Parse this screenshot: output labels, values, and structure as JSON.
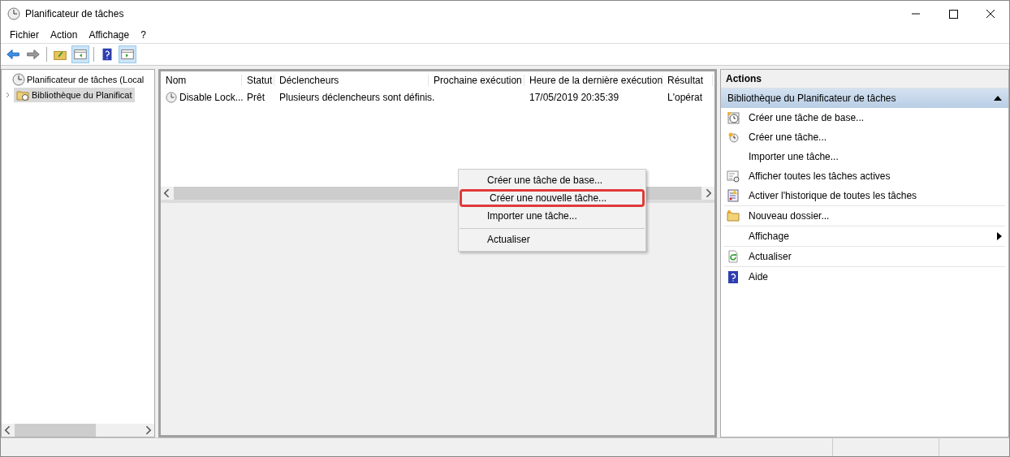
{
  "window": {
    "title": "Planificateur de tâches"
  },
  "menu": [
    "Fichier",
    "Action",
    "Affichage",
    "?"
  ],
  "toolbar": [
    {
      "kind": "back",
      "pressed": false
    },
    {
      "kind": "forward",
      "pressed": false
    },
    {
      "kind": "sep"
    },
    {
      "kind": "up",
      "pressed": false
    },
    {
      "kind": "pane-left",
      "pressed": true
    },
    {
      "kind": "sep"
    },
    {
      "kind": "help",
      "pressed": false
    },
    {
      "kind": "pane-right",
      "pressed": true
    }
  ],
  "tree": [
    {
      "label": "Planificateur de tâches (Local",
      "selected": false,
      "children": [
        {
          "label": "Bibliothèque du Planificat",
          "expanded": false,
          "selected": true
        }
      ]
    }
  ],
  "table": {
    "columns": [
      "Nom",
      "Statut",
      "Déclencheurs",
      "Prochaine exécution",
      "Heure de la dernière exécution",
      "Résultat"
    ],
    "rows": [
      [
        "Disable Lock...",
        "Prêt",
        "Plusieurs déclencheurs sont définis.",
        "",
        "17/05/2019 20:35:39",
        "L'opérat"
      ]
    ]
  },
  "context_menu": [
    {
      "label": "Créer une tâche de base...",
      "highlighted": false,
      "divider_before": false
    },
    {
      "label": "Créer une nouvelle tâche...",
      "highlighted": true,
      "divider_before": false
    },
    {
      "label": "Importer une tâche...",
      "highlighted": false,
      "divider_before": false
    },
    {
      "label": "Actualiser",
      "highlighted": false,
      "divider_before": true
    }
  ],
  "actions": {
    "title": "Actions",
    "section": "Bibliothèque du Planificateur de tâches",
    "items": [
      {
        "label": "Créer une tâche de base...",
        "submenu": false,
        "divider": false
      },
      {
        "label": "Créer une tâche...",
        "submenu": false,
        "divider": false
      },
      {
        "label": "Importer une tâche...",
        "submenu": false,
        "divider": false
      },
      {
        "label": "Afficher toutes les tâches actives",
        "submenu": false,
        "divider": false
      },
      {
        "label": "Activer l'historique de toutes les tâches",
        "submenu": false,
        "divider": true
      },
      {
        "label": "Nouveau dossier...",
        "submenu": false,
        "divider": true
      },
      {
        "label": "Affichage",
        "submenu": true,
        "divider": true
      },
      {
        "label": "Actualiser",
        "submenu": false,
        "divider": true
      },
      {
        "label": "Aide",
        "submenu": false,
        "divider": false
      }
    ]
  }
}
